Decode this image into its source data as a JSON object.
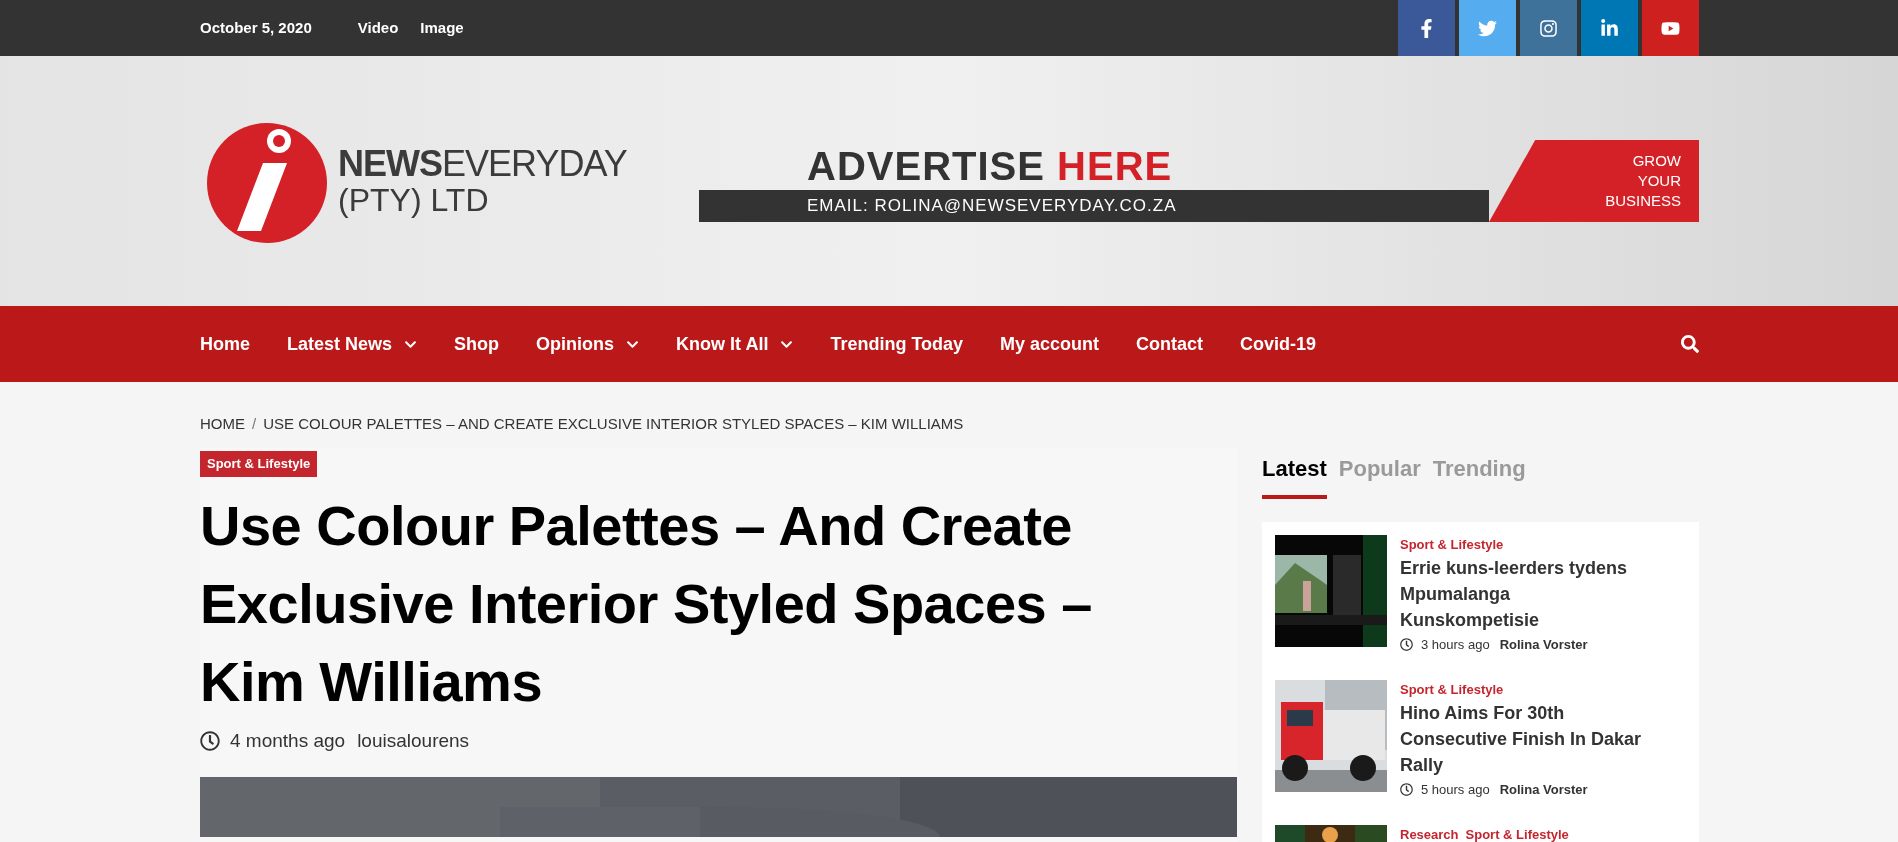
{
  "top_bar": {
    "date": "October 5, 2020",
    "links": [
      "Video",
      "Image"
    ],
    "social": [
      {
        "kind": "facebook",
        "color": "#3b5998"
      },
      {
        "kind": "twitter",
        "color": "#55acee"
      },
      {
        "kind": "instagram",
        "color": "#3f729b"
      },
      {
        "kind": "linkedin",
        "color": "#0077b5"
      },
      {
        "kind": "youtube",
        "color": "#cd201f"
      }
    ]
  },
  "logo": {
    "bold": "NEWS",
    "light": "EVERYDAY",
    "sub": "(PTY) LTD"
  },
  "ad": {
    "headline": "ADVERTISE",
    "headline_accent": "HERE",
    "email": "EMAIL: ROLINA@NEWSEVERYDAY.CO.ZA",
    "tagline": [
      "GROW",
      "YOUR",
      "BUSINESS"
    ]
  },
  "nav": [
    {
      "label": "Home",
      "dropdown": false
    },
    {
      "label": "Latest News",
      "dropdown": true
    },
    {
      "label": "Shop",
      "dropdown": false
    },
    {
      "label": "Opinions",
      "dropdown": true
    },
    {
      "label": "Know It All",
      "dropdown": true
    },
    {
      "label": "Trending Today",
      "dropdown": false
    },
    {
      "label": "My account",
      "dropdown": false
    },
    {
      "label": "Contact",
      "dropdown": false
    },
    {
      "label": "Covid-19",
      "dropdown": false
    }
  ],
  "breadcrumb_separator": "/",
  "breadcrumb": [
    "HOME",
    "USE COLOUR PALETTES – AND CREATE EXCLUSIVE INTERIOR STYLED SPACES – KIM WILLIAMS"
  ],
  "article": {
    "category": "Sport & Lifestyle",
    "title": "Use Colour Palettes – And Create Exclusive Interior Styled Spaces – Kim Williams",
    "time": "4 months ago",
    "author": "louisalourens"
  },
  "sidebar": {
    "tabs": [
      {
        "label": "Latest",
        "selected": true
      },
      {
        "label": "Popular",
        "selected": false
      },
      {
        "label": "Trending",
        "selected": false
      }
    ],
    "posts": [
      {
        "categories": [
          "Sport & Lifestyle"
        ],
        "title": "Errie kuns-leerders tydens Mpumalanga Kunskompetisie",
        "time": "3 hours ago",
        "author": "Rolina Vorster"
      },
      {
        "categories": [
          "Sport & Lifestyle"
        ],
        "title": "Hino Aims For 30th Consecutive Finish In Dakar Rally",
        "time": "5 hours ago",
        "author": "Rolina Vorster"
      },
      {
        "categories": [
          "Research",
          "Sport & Lifestyle"
        ]
      }
    ]
  }
}
